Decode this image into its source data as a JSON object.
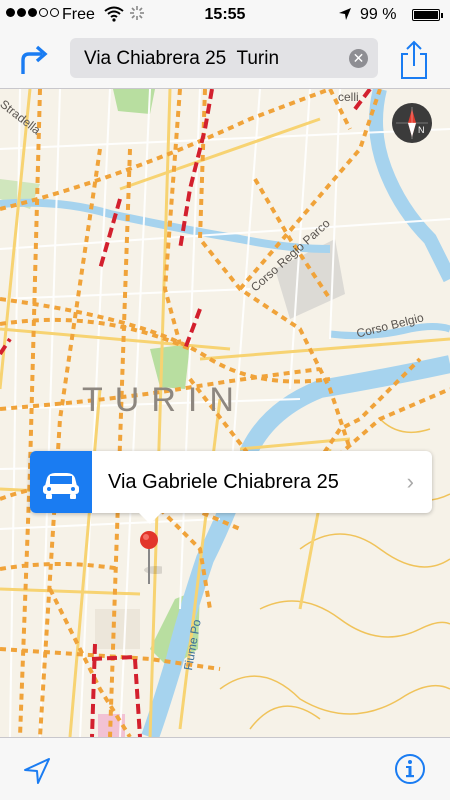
{
  "status_bar": {
    "carrier": "Free",
    "time": "15:55",
    "battery": "99 %",
    "battery_level": 0.99,
    "signal_bars": 3,
    "signal_total": 5
  },
  "nav": {
    "search_text": "Via Chiabrera 25  Turin"
  },
  "map": {
    "city_label": "TURIN",
    "streets": [
      "Stradella",
      "Corso Regio Parco",
      "Corso Belgio",
      "Fiume Po",
      "celli"
    ],
    "compass_letter": "N"
  },
  "callout": {
    "title": "Via Gabriele Chiabrera 25"
  },
  "colors": {
    "accent": "#1a7cf2",
    "road_major": "#f0a33a",
    "road_highway": "#d3202e",
    "water": "#a6d3ee",
    "park": "#b8dea0"
  },
  "icons": {
    "directions": "turn-arrow-icon",
    "share": "share-icon",
    "clear": "clear-icon",
    "location": "location-arrow-icon",
    "info": "info-icon",
    "car": "car-icon",
    "pin": "map-pin-icon"
  }
}
